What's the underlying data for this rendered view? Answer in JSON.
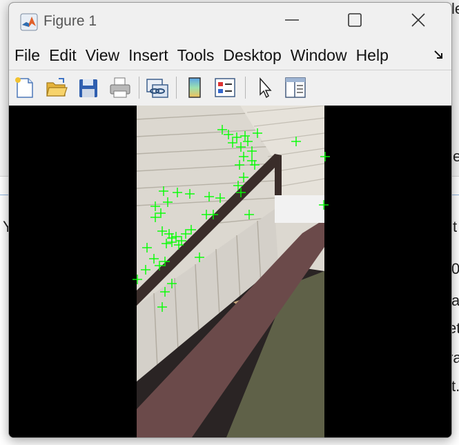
{
  "window": {
    "title": "Figure 1",
    "icon": "matlab-logo-icon"
  },
  "window_controls": [
    "minimize-icon",
    "maximize-icon",
    "close-icon"
  ],
  "menu": {
    "items": [
      "File",
      "Edit",
      "View",
      "Insert",
      "Tools",
      "Desktop",
      "Window",
      "Help"
    ],
    "overflow_icon": "dock-arrow-icon"
  },
  "toolbar": {
    "buttons": [
      {
        "name": "new-figure-button",
        "icon": "new-file-icon"
      },
      {
        "name": "open-file-button",
        "icon": "folder-open-icon"
      },
      {
        "name": "save-figure-button",
        "icon": "floppy-disk-icon"
      },
      {
        "name": "print-figure-button",
        "icon": "printer-icon"
      },
      {
        "name": "link-plot-button",
        "icon": "link-plot-icon"
      },
      {
        "name": "insert-colorbar-button",
        "icon": "colorbar-icon"
      },
      {
        "name": "insert-legend-button",
        "icon": "legend-icon"
      },
      {
        "name": "edit-plot-button",
        "icon": "pointer-arrow-icon"
      },
      {
        "name": "property-inspector-button",
        "icon": "property-panel-icon"
      }
    ]
  },
  "figure": {
    "content": "image with detected feature points",
    "marker_color": "#00ff00",
    "marker": "plus"
  },
  "background_text": {
    "right_fragments": [
      "le",
      "e",
      "t",
      "0",
      "a",
      "et",
      "ra",
      "t."
    ],
    "left_fragment": "Y"
  }
}
